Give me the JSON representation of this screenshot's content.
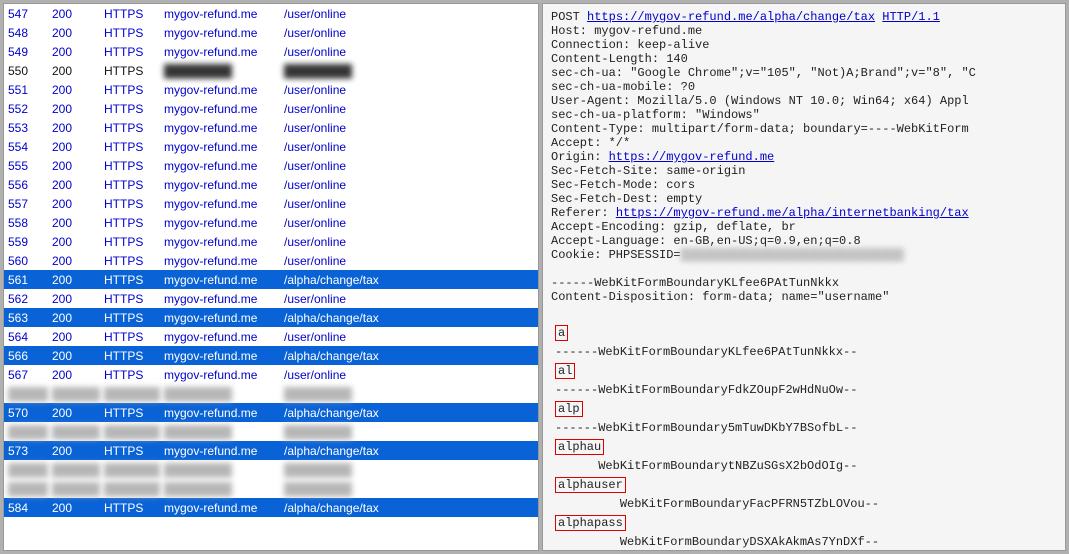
{
  "requests": [
    {
      "id": "547",
      "status": "200",
      "proto": "HTTPS",
      "host": "mygov-refund.me",
      "path": "/user/online",
      "cls": "row-normal"
    },
    {
      "id": "548",
      "status": "200",
      "proto": "HTTPS",
      "host": "mygov-refund.me",
      "path": "/user/online",
      "cls": "row-normal"
    },
    {
      "id": "549",
      "status": "200",
      "proto": "HTTPS",
      "host": "mygov-refund.me",
      "path": "/user/online",
      "cls": "row-normal"
    },
    {
      "id": "550",
      "status": "200",
      "proto": "HTTPS",
      "host": "████████████████",
      "path": "████████████████████",
      "cls": "row-dark",
      "blurCols": [
        "host",
        "path"
      ]
    },
    {
      "id": "551",
      "status": "200",
      "proto": "HTTPS",
      "host": "mygov-refund.me",
      "path": "/user/online",
      "cls": "row-normal"
    },
    {
      "id": "552",
      "status": "200",
      "proto": "HTTPS",
      "host": "mygov-refund.me",
      "path": "/user/online",
      "cls": "row-normal"
    },
    {
      "id": "553",
      "status": "200",
      "proto": "HTTPS",
      "host": "mygov-refund.me",
      "path": "/user/online",
      "cls": "row-normal"
    },
    {
      "id": "554",
      "status": "200",
      "proto": "HTTPS",
      "host": "mygov-refund.me",
      "path": "/user/online",
      "cls": "row-normal"
    },
    {
      "id": "555",
      "status": "200",
      "proto": "HTTPS",
      "host": "mygov-refund.me",
      "path": "/user/online",
      "cls": "row-normal"
    },
    {
      "id": "556",
      "status": "200",
      "proto": "HTTPS",
      "host": "mygov-refund.me",
      "path": "/user/online",
      "cls": "row-normal"
    },
    {
      "id": "557",
      "status": "200",
      "proto": "HTTPS",
      "host": "mygov-refund.me",
      "path": "/user/online",
      "cls": "row-normal"
    },
    {
      "id": "558",
      "status": "200",
      "proto": "HTTPS",
      "host": "mygov-refund.me",
      "path": "/user/online",
      "cls": "row-normal"
    },
    {
      "id": "559",
      "status": "200",
      "proto": "HTTPS",
      "host": "mygov-refund.me",
      "path": "/user/online",
      "cls": "row-normal"
    },
    {
      "id": "560",
      "status": "200",
      "proto": "HTTPS",
      "host": "mygov-refund.me",
      "path": "/user/online",
      "cls": "row-normal"
    },
    {
      "id": "561",
      "status": "200",
      "proto": "HTTPS",
      "host": "mygov-refund.me",
      "path": "/alpha/change/tax",
      "cls": "row-sel"
    },
    {
      "id": "562",
      "status": "200",
      "proto": "HTTPS",
      "host": "mygov-refund.me",
      "path": "/user/online",
      "cls": "row-normal"
    },
    {
      "id": "563",
      "status": "200",
      "proto": "HTTPS",
      "host": "mygov-refund.me",
      "path": "/alpha/change/tax",
      "cls": "row-sel"
    },
    {
      "id": "564",
      "status": "200",
      "proto": "HTTPS",
      "host": "mygov-refund.me",
      "path": "/user/online",
      "cls": "row-normal"
    },
    {
      "id": "566",
      "status": "200",
      "proto": "HTTPS",
      "host": "mygov-refund.me",
      "path": "/alpha/change/tax",
      "cls": "row-sel"
    },
    {
      "id": "567",
      "status": "200",
      "proto": "HTTPS",
      "host": "mygov-refund.me",
      "path": "/user/online",
      "cls": "row-normal"
    },
    {
      "id": "",
      "status": "",
      "proto": "",
      "host": "████████████████",
      "path": "████████████████████",
      "cls": "row-blur",
      "blurCols": [
        "id",
        "status",
        "proto",
        "host",
        "path"
      ]
    },
    {
      "id": "570",
      "status": "200",
      "proto": "HTTPS",
      "host": "mygov-refund.me",
      "path": "/alpha/change/tax",
      "cls": "row-sel"
    },
    {
      "id": "",
      "status": "",
      "proto": "",
      "host": "████████████████",
      "path": "████████████████",
      "cls": "row-blur",
      "blurCols": [
        "id",
        "status",
        "proto",
        "host",
        "path"
      ]
    },
    {
      "id": "573",
      "status": "200",
      "proto": "HTTPS",
      "host": "mygov-refund.me",
      "path": "/alpha/change/tax",
      "cls": "row-sel"
    },
    {
      "id": "",
      "status": "",
      "proto": "",
      "host": "████████████████",
      "path": "████████████████████",
      "cls": "row-blur",
      "blurCols": [
        "id",
        "status",
        "proto",
        "host",
        "path"
      ]
    },
    {
      "id": "",
      "status": "",
      "proto": "",
      "host": "████████████████",
      "path": "████████████████",
      "cls": "row-blur",
      "blurCols": [
        "id",
        "status",
        "proto",
        "host",
        "path"
      ]
    },
    {
      "id": "584",
      "status": "200",
      "proto": "HTTPS",
      "host": "mygov-refund.me",
      "path": "/alpha/change/tax",
      "cls": "row-sel"
    }
  ],
  "raw": {
    "method": "POST",
    "url": "https://mygov-refund.me/alpha/change/tax",
    "httpver": "HTTP/1.1",
    "headers": [
      "Host: mygov-refund.me",
      "Connection: keep-alive",
      "Content-Length: 140",
      "sec-ch-ua: \"Google Chrome\";v=\"105\", \"Not)A;Brand\";v=\"8\", \"C",
      "sec-ch-ua-mobile: ?0",
      "User-Agent: Mozilla/5.0 (Windows NT 10.0; Win64; x64) Appl",
      "sec-ch-ua-platform: \"Windows\"",
      "Content-Type: multipart/form-data; boundary=----WebKitForm",
      "Accept: */*"
    ],
    "origin_label": "Origin: ",
    "origin_url": "https://mygov-refund.me",
    "headers2a": [
      "Sec-Fetch-Site: same-origin",
      "Sec-Fetch-Mode: cors",
      "Sec-Fetch-Dest: empty"
    ],
    "referer_label": "Referer: ",
    "referer_url": "https://mygov-refund.me/alpha/internetbanking/tax",
    "headers2b": [
      "Accept-Encoding: gzip, deflate, br",
      "Accept-Language: en-GB,en-US;q=0.9,en;q=0.8"
    ],
    "cookie_prefix": "Cookie: PHPSESSID=",
    "cookie_blur": "███████████████████████████████",
    "body_pre": [
      "",
      "------WebKitFormBoundaryKLfee6PAtTunNkkx",
      "Content-Disposition: form-data; name=\"username\"",
      ""
    ]
  },
  "fragments": [
    {
      "value": "a",
      "tail": "-----WebKitFormBoundaryKLfee6PAtTunNkkx--",
      "indent": 0,
      "tailIndent": 0,
      "tailPrefix": "-"
    },
    {
      "value": "al",
      "tail": "----WebKitFormBoundaryFdkZOupF2wHdNuOw--",
      "indent": 0,
      "tailIndent": 0,
      "tailPrefix": "--"
    },
    {
      "value": "alp",
      "tail": "---WebKitFormBoundary5mTuwDKbY7BSofbL--",
      "indent": 0,
      "tailIndent": 0,
      "tailPrefix": "---"
    },
    {
      "value": "alphau",
      "tail": "WebKitFormBoundarytNBZuSGsX2bOdOIg--",
      "indent": 0,
      "tailIndent": 6,
      "tailPrefix": ""
    },
    {
      "value": "alphauser",
      "tail": "WebKitFormBoundaryFacPFRN5TZbLOVou--",
      "indent": 0,
      "tailIndent": 9,
      "tailPrefix": ""
    },
    {
      "value": "alphapass",
      "tail": "WebKitFormBoundaryDSXAkAkmAs7YnDXf--",
      "indent": 0,
      "tailIndent": 9,
      "tailPrefix": ""
    }
  ]
}
